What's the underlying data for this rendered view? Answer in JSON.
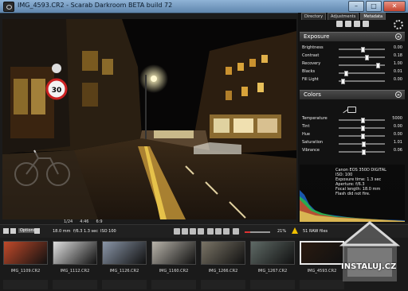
{
  "window": {
    "title": "IMG_4593.CR2 - Scarab Darkroom BETA build 72",
    "buttons": {
      "minimize": "–",
      "maximize": "□",
      "close": "✕"
    }
  },
  "tabs": [
    "Directory",
    "Adjustments",
    "Metadata"
  ],
  "exposure": {
    "title": "Exposure",
    "rows": [
      {
        "name": "Brightness",
        "value": "0.00",
        "pos": 0.5
      },
      {
        "name": "Contrast",
        "value": "0.18",
        "pos": 0.6
      },
      {
        "name": "Recovery",
        "value": "1.00",
        "pos": 0.85
      },
      {
        "name": "Blacks",
        "value": "0.01",
        "pos": 0.12
      },
      {
        "name": "Fill Light",
        "value": "0.00",
        "pos": 0.05
      }
    ]
  },
  "colors": {
    "title": "Colors",
    "rows": [
      {
        "name": "Temperature",
        "value": "5000",
        "pos": 0.5
      },
      {
        "name": "Tint",
        "value": "0.00",
        "pos": 0.5
      },
      {
        "name": "Hue",
        "value": "0.00",
        "pos": 0.5
      },
      {
        "name": "Saturation",
        "value": "1.01",
        "pos": 0.52
      },
      {
        "name": "Vibrance",
        "value": "0.06",
        "pos": 0.53
      }
    ]
  },
  "metadata": [
    "Canon EOS 350D DIGITAL",
    "ISO: 100",
    "Exposure time: 1.3 sec",
    "Aperture: f/6.3",
    "Focal length: 18.0 mm",
    "Flash did not fire."
  ],
  "histogram_labels": [
    "1/24",
    "4:46",
    "6:9"
  ],
  "bottombar": {
    "options": "Options",
    "focal": "18.0 mm",
    "aperture": "f/6.3",
    "exposure": "1.3 sec",
    "iso": "ISO 100",
    "zoom": "21%",
    "zoom_value": 0.21,
    "raw_count": "51 RAW files"
  },
  "filmstrip": [
    {
      "name": "IMG_1109.CR2",
      "color": "#c24a2a",
      "selected": false
    },
    {
      "name": "IMG_1112.CR2",
      "color": "#e0e0e0",
      "selected": false
    },
    {
      "name": "IMG_1126.CR2",
      "color": "#8a96a8",
      "selected": false
    },
    {
      "name": "IMG_1160.CR2",
      "color": "#b8b4aa",
      "selected": false
    },
    {
      "name": "IMG_1266.CR2",
      "color": "#7a7466",
      "selected": false
    },
    {
      "name": "IMG_1267.CR2",
      "color": "#5f6a66",
      "selected": false
    },
    {
      "name": "IMG_4593.CR2",
      "color": "#2a1a10",
      "selected": true
    }
  ],
  "watermark": "INSTALUJ.CZ",
  "photo_sign_number": "30"
}
